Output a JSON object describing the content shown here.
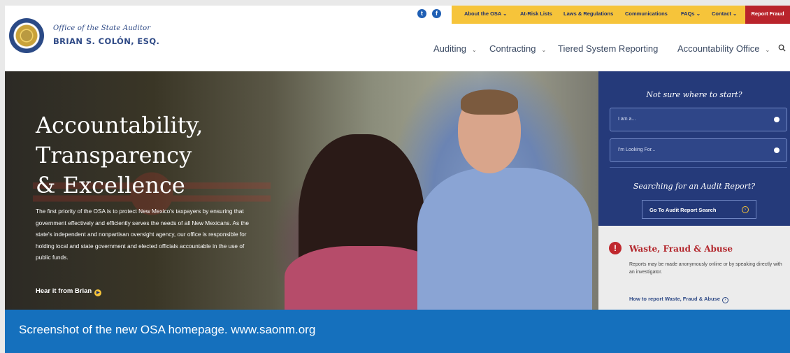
{
  "header": {
    "office_line": "Office of the State Auditor",
    "auditor_name": "BRIAN S. COLÓN, ESQ.",
    "social": [
      {
        "icon": "twitter-icon",
        "glyph": "t"
      },
      {
        "icon": "facebook-icon",
        "glyph": "f"
      }
    ],
    "top_links": [
      {
        "label": "About the OSA",
        "has_caret": true
      },
      {
        "label": "At-Risk Lists",
        "has_caret": false
      },
      {
        "label": "Laws & Regulations",
        "has_caret": false
      },
      {
        "label": "Communications",
        "has_caret": false
      },
      {
        "label": "FAQs",
        "has_caret": true
      },
      {
        "label": "Contact",
        "has_caret": true
      }
    ],
    "report_fraud": "Report Fraud",
    "main_nav": [
      {
        "label": "Auditing",
        "has_caret": true
      },
      {
        "label": "Contracting",
        "has_caret": true
      },
      {
        "label": "Tiered System Reporting",
        "has_caret": false
      },
      {
        "label": "Accountability Office",
        "has_caret": true
      }
    ]
  },
  "hero": {
    "title_lines": [
      "Accountability,",
      "Transparency",
      "& Excellence"
    ],
    "body": "The first priority of the OSA is to protect New Mexico's taxpayers by ensuring that government effectively and efficiently serves the needs of all New Mexicans. As the state's independent and nonpartisan oversight agency, our office is responsible for holding local and state government and elected officials accountable in the use of public funds.",
    "cta": "Hear it from Brian"
  },
  "panel": {
    "heading": "Not sure where to start?",
    "field1": "I am a...",
    "field2": "I'm Looking For...",
    "audit_heading": "Searching for an Audit Report?",
    "audit_button": "Go To Audit Report Search"
  },
  "waste": {
    "title": "Waste, Fraud & Abuse",
    "text": "Reports may be made anonymously online or by speaking directly with an investigator.",
    "link": "How to report Waste, Fraud & Abuse"
  },
  "caption": "Screenshot of the new OSA homepage. www.saonm.org",
  "colors": {
    "brand_blue": "#2f4a86",
    "panel_blue": "#253a7a",
    "topbar_yellow": "#f6c43a",
    "fraud_red": "#b9242b",
    "caption_blue": "#1570bd"
  }
}
